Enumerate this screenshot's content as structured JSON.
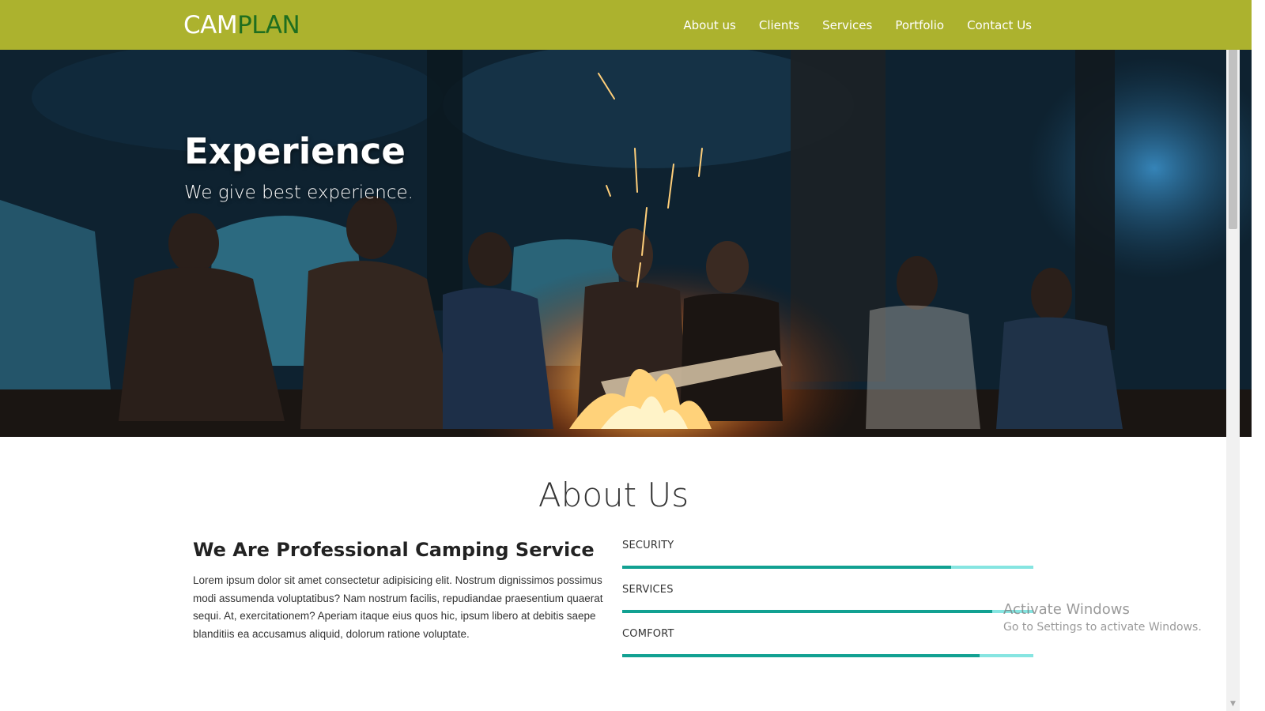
{
  "navbar": {
    "logo_part1": "CAM",
    "logo_part2": "PLAN",
    "links": [
      "About us",
      "Clients",
      "Services",
      "Portfolio",
      "Contact Us"
    ],
    "background_color": "#acb22e"
  },
  "hero": {
    "title": "Experience",
    "subtitle": "We give best experience."
  },
  "about": {
    "heading": "About Us",
    "subtitle": "We Are Professional Camping Service",
    "text": "Lorem ipsum dolor sit amet consectetur adipisicing elit. Nostrum dignissimos possimus modi assumenda voluptatibus? Nam nostrum facilis, repudiandae praesentium quaerat sequi. At, exercitationem? Aperiam itaque eius quos hic, ipsum libero at debitis saepe blanditiis ea accusamus aliquid, dolorum ratione voluptate.",
    "skills": [
      {
        "label": "SECURITY",
        "percent": 80
      },
      {
        "label": "SERVICES",
        "percent": 90
      },
      {
        "label": "COMFORT",
        "percent": 87
      }
    ],
    "bar_fill_color": "#12a192",
    "bar_track_color": "#86e5e1"
  },
  "watermark": {
    "title": "Activate Windows",
    "subtitle": "Go to Settings to activate Windows."
  }
}
